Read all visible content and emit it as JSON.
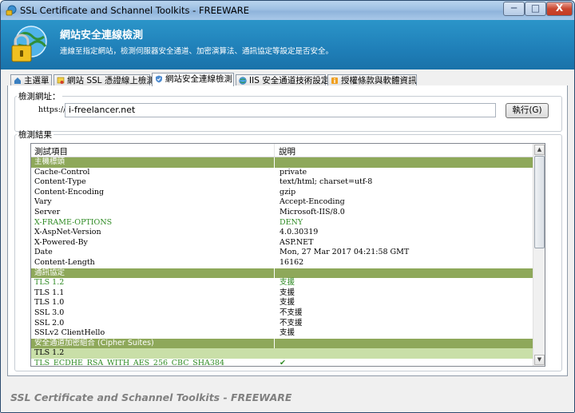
{
  "window": {
    "title": "SSL Certificate and Schannel Toolkits - FREEWARE",
    "min_glyph": "─",
    "max_glyph": "□",
    "close_glyph": "X"
  },
  "header": {
    "title": "網站安全連線檢測",
    "subtitle": "連線至指定網站，檢測伺服器安全通道、加密演算法、通訊協定等設定是否安全。"
  },
  "tabs": [
    {
      "label": "主選單",
      "icon": "house-icon"
    },
    {
      "label": "網站 SSL 憑證線上檢測",
      "icon": "certificate-icon"
    },
    {
      "label": "網站安全連線檢測",
      "icon": "shield-check-icon",
      "active": true
    },
    {
      "label": "IIS 安全通道技術設定",
      "icon": "globe-gear-icon"
    },
    {
      "label": "授權條款與軟體資訊",
      "icon": "info-icon"
    }
  ],
  "url_group": {
    "legend": "檢測網址：",
    "prefix": "https://",
    "value": "i-freelancer.net",
    "run_label": "執行(G)"
  },
  "results_group": {
    "legend": "檢測結果"
  },
  "table": {
    "headers": [
      "測試項目",
      "說明"
    ],
    "rows": [
      {
        "type": "section",
        "c1": "主機標頭",
        "c2": ""
      },
      {
        "type": "normal",
        "c1": "Cache-Control",
        "c2": "private"
      },
      {
        "type": "normal",
        "c1": "Content-Type",
        "c2": "text/html; charset=utf-8"
      },
      {
        "type": "normal",
        "c1": "Content-Encoding",
        "c2": "gzip"
      },
      {
        "type": "normal",
        "c1": "Vary",
        "c2": "Accept-Encoding"
      },
      {
        "type": "normal",
        "c1": "Server",
        "c2": "Microsoft-IIS/8.0"
      },
      {
        "type": "green",
        "c1": "X-FRAME-OPTIONS",
        "c2": "DENY"
      },
      {
        "type": "normal",
        "c1": "X-AspNet-Version",
        "c2": "4.0.30319"
      },
      {
        "type": "normal",
        "c1": "X-Powered-By",
        "c2": "ASP.NET"
      },
      {
        "type": "normal",
        "c1": "Date",
        "c2": "Mon, 27 Mar 2017 04:21:58 GMT"
      },
      {
        "type": "normal",
        "c1": "Content-Length",
        "c2": "16162"
      },
      {
        "type": "section",
        "c1": "通訊協定",
        "c2": ""
      },
      {
        "type": "green",
        "c1": "TLS 1.2",
        "c2": "支援"
      },
      {
        "type": "normal",
        "c1": "TLS 1.1",
        "c2": "支援"
      },
      {
        "type": "normal",
        "c1": "TLS 1.0",
        "c2": "支援"
      },
      {
        "type": "normal",
        "c1": "SSL 3.0",
        "c2": "不支援"
      },
      {
        "type": "normal",
        "c1": "SSL 2.0",
        "c2": "不支援"
      },
      {
        "type": "normal",
        "c1": "SSLv2 ClientHello",
        "c2": "支援"
      },
      {
        "type": "section",
        "c1": "安全通道加密組合 (Cipher Suites)",
        "c2": ""
      },
      {
        "type": "highlight",
        "c1": "TLS 1.2",
        "c2": ""
      },
      {
        "type": "green",
        "c1": "TLS_ECDHE_RSA_WITH_AES_256_CBC_SHA384",
        "c2": "✔"
      }
    ]
  },
  "scrollbar": {
    "up_glyph": "▲",
    "down_glyph": "▼"
  },
  "footer": {
    "text": "SSL Certificate and Schannel Toolkits - FREEWARE"
  },
  "colors": {
    "header_blue": "#1f7fb8",
    "section_green": "#8ea85a",
    "highlight_green": "#c9dfa8",
    "ok_green": "#2e8a23"
  }
}
